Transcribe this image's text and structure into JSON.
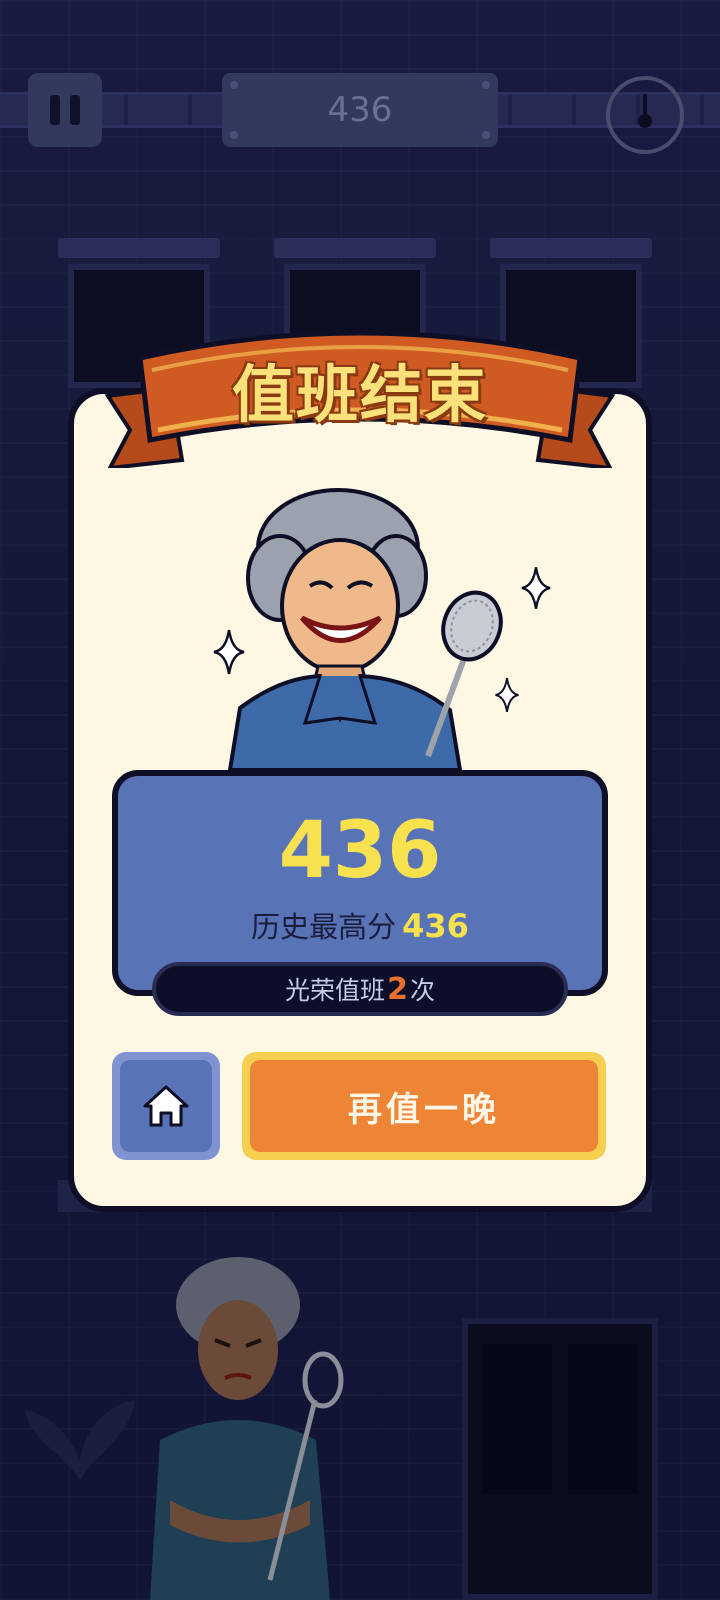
{
  "hud": {
    "score": "436",
    "pause_icon": "pause-icon",
    "timer_icon": "stopwatch-icon"
  },
  "result": {
    "title": "值班结束",
    "score": "436",
    "best_label": "历史最高分",
    "best_score": "436",
    "honor_prefix": "光荣值班",
    "honor_count": "2",
    "honor_suffix": "次"
  },
  "buttons": {
    "home_icon": "home-icon",
    "play_again": "再值一晚"
  },
  "colors": {
    "background": "#15173a",
    "card": "#fdf7e4",
    "banner": "#cf5a22",
    "panel_blue": "#5873b6",
    "score_yellow": "#f8e14e",
    "button_orange": "#ee8435",
    "honor_count": "#e9702e"
  }
}
